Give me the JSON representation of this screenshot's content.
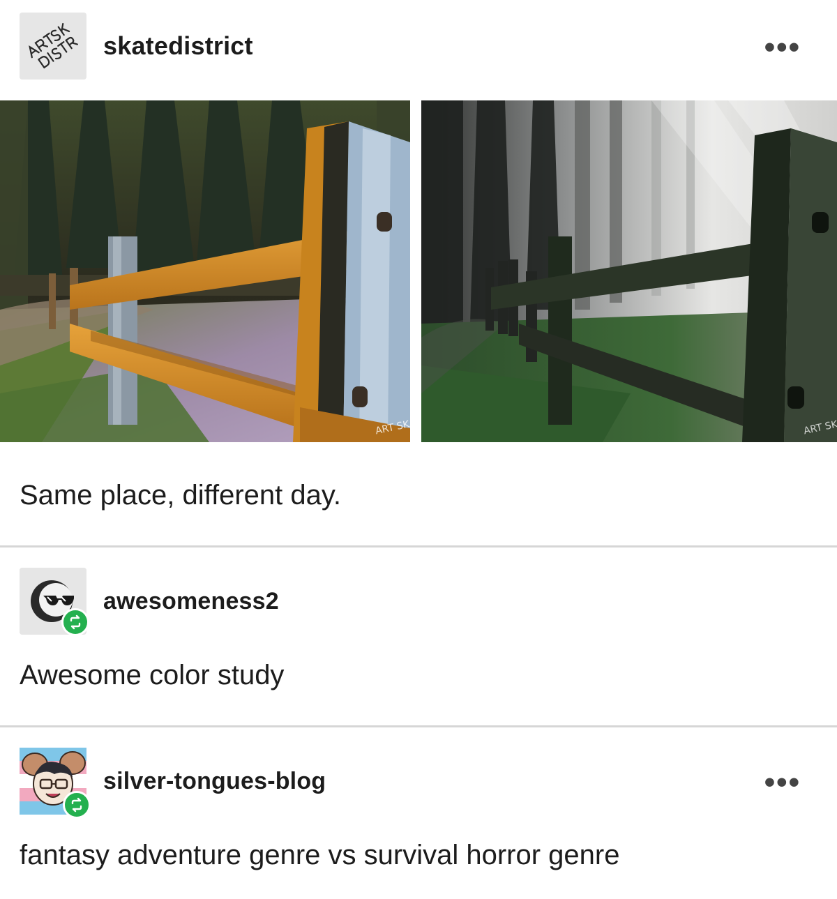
{
  "original_post": {
    "username": "skatedistrict",
    "avatar_text": "ARTSKATE DISTRICT",
    "more_label": "•••",
    "caption": "Same place, different day.",
    "image_left_watermark": "ART SKATE DISTRICT",
    "image_right_watermark": "ART SKATE DISTRICT"
  },
  "reblogs": [
    {
      "username": "awesomeness2",
      "comment": "Awesome color study",
      "avatar_icon": "sunglasses-face-icon"
    },
    {
      "username": "silver-tongues-blog",
      "comment": "fantasy adventure genre vs survival horror genre",
      "more_label": "•••",
      "avatar_icon": "mouse-character-icon"
    }
  ],
  "colors": {
    "reblog_green": "#24b04f",
    "divider": "#d6d6d6",
    "text": "#1c1c1c"
  }
}
